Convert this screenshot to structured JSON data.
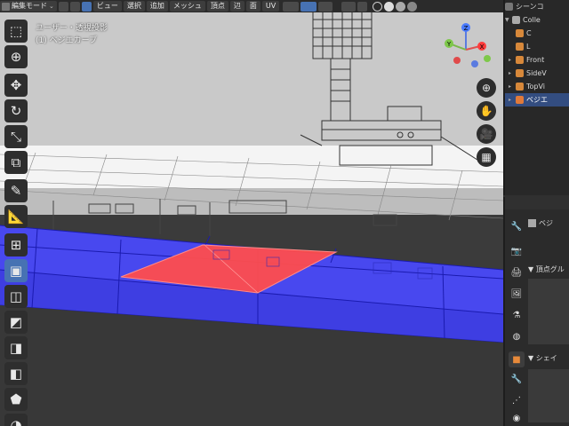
{
  "header": {
    "mode_label": "編集モード",
    "menu": [
      "ビュー",
      "選択",
      "追加",
      "メッシュ",
      "頂点",
      "辺",
      "面",
      "UV"
    ]
  },
  "viewport": {
    "view_name": "ユーザー・透視投影",
    "object_name": "(1) ベジエカーブ",
    "gizmo_axes": {
      "x": "X",
      "y": "Y",
      "z": "Z"
    },
    "colors": {
      "selected_face": "#ff4d4d",
      "mesh_face": "#4a4aff",
      "edge": "#1b1bb0",
      "grid": "#444444"
    }
  },
  "toolbar": {
    "tools": [
      "select-box-icon",
      "cursor-icon",
      "move-icon",
      "rotate-icon",
      "scale-icon",
      "transform-icon",
      "annotate-icon",
      "measure-icon",
      "add-cube-icon",
      "extrude-region-icon",
      "inset-faces-icon",
      "bevel-icon",
      "loop-cut-icon",
      "knife-icon",
      "poly-build-icon",
      "spin-icon"
    ]
  },
  "outliner": {
    "items": [
      {
        "label": "シーンコ"
      },
      {
        "label": "Colle"
      },
      {
        "label": "C"
      },
      {
        "label": "L"
      },
      {
        "label": "Front"
      },
      {
        "label": "SideV"
      },
      {
        "label": "TopVi"
      },
      {
        "label": "ベジエ"
      }
    ]
  },
  "properties": {
    "object_label": "ベジ",
    "vertex_groups_label": "頂点グル",
    "shape_keys_label": "シェイ"
  }
}
